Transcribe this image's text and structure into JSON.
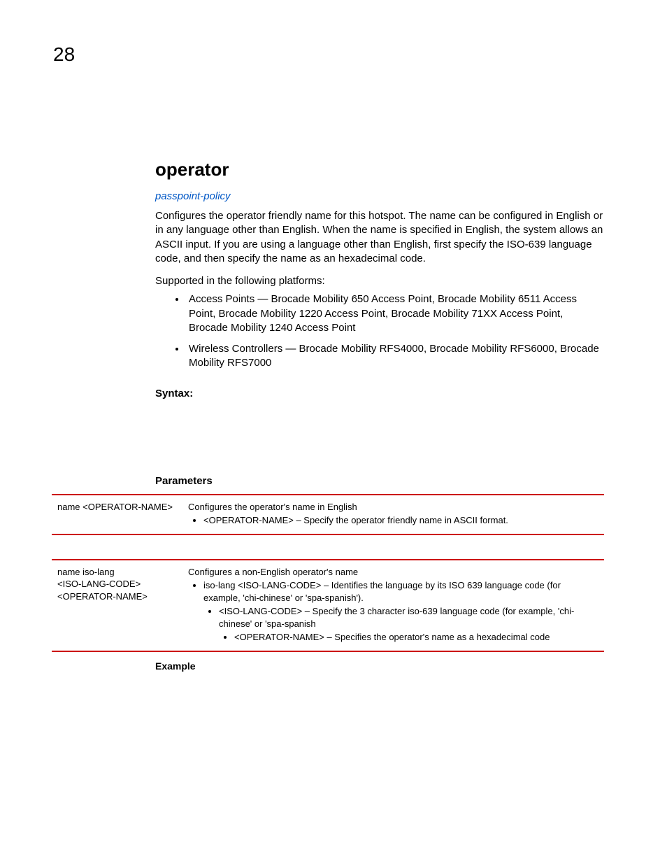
{
  "pageNumber": "28",
  "heading": "operator",
  "link": "passpoint-policy",
  "intro": "Configures the operator friendly name for this hotspot. The name can be configured in English or in any language other than English. When the name is specified in English, the system allows an ASCII input. If you are using a language other than English, first specify the ISO-639 language code, and then specify the name as an hexadecimal code.",
  "supportedLabel": "Supported in the following platforms:",
  "platforms": [
    "Access Points — Brocade Mobility 650 Access Point, Brocade Mobility 6511 Access Point, Brocade Mobility 1220 Access Point, Brocade Mobility 71XX Access Point, Brocade Mobility 1240 Access Point",
    "Wireless Controllers — Brocade Mobility RFS4000, Brocade Mobility RFS6000, Brocade Mobility RFS7000"
  ],
  "syntaxLabel": "Syntax:",
  "parametersLabel": "Parameters",
  "table1": {
    "left": "name <OPERATOR-NAME>",
    "rightTop": "Configures the operator's name in English",
    "bullet1": "<OPERATOR-NAME> – Specify the operator friendly name in ASCII format."
  },
  "table2": {
    "leftLine1": "name iso-lang",
    "leftLine2": "<ISO-LANG-CODE>",
    "leftLine3": "<OPERATOR-NAME>",
    "rightTop": "Configures a non-English operator's name",
    "bullet1": "iso-lang <ISO-LANG-CODE> – Identifies the language by its ISO 639 language code (for example, 'chi-chinese' or 'spa-spanish').",
    "sub1": "<ISO-LANG-CODE> – Specify the 3 character iso-639 language code (for example, 'chi-chinese' or 'spa-spanish",
    "subsub1": "<OPERATOR-NAME> – Specifies the operator's name as a hexadecimal code"
  },
  "exampleLabel": "Example"
}
